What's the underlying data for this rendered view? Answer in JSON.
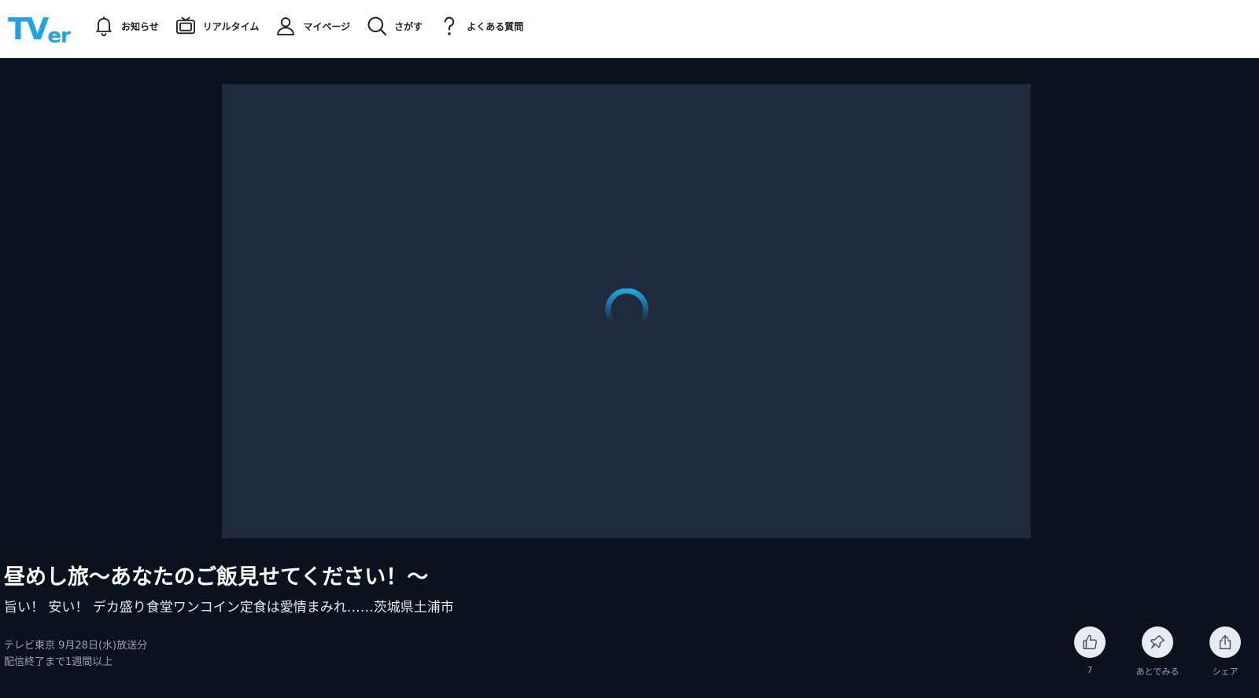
{
  "header": {
    "logo": {
      "tv": "TV",
      "er": "er"
    },
    "nav": [
      {
        "label": "お知らせ",
        "icon": "bell-icon"
      },
      {
        "label": "リアルタイム",
        "icon": "tv-icon"
      },
      {
        "label": "マイページ",
        "icon": "user-icon"
      },
      {
        "label": "さがす",
        "icon": "search-icon"
      },
      {
        "label": "よくある質問",
        "icon": "question-icon"
      }
    ]
  },
  "player": {
    "state": "loading",
    "spinner_color": "#1fa3e3"
  },
  "episode": {
    "title": "昼めし旅～あなたのご飯見せてください！～",
    "subtitle": "旨い！ 安い！ デカ盛り食堂ワンコイン定食は愛情まみれ……茨城県土浦市",
    "broadcast": "テレビ東京 9月28日(水)放送分",
    "availability": "配信終了まで1週間以上"
  },
  "actions": [
    {
      "label": "7",
      "icon": "thumbs-up-icon"
    },
    {
      "label": "あとでみる",
      "icon": "pin-icon"
    },
    {
      "label": "シェア",
      "icon": "share-icon"
    }
  ],
  "colors": {
    "accent": "#1fa3e3",
    "page_bg": "#0b111d",
    "player_bg": "#1f2a3c",
    "header_bg": "#ffffff"
  }
}
